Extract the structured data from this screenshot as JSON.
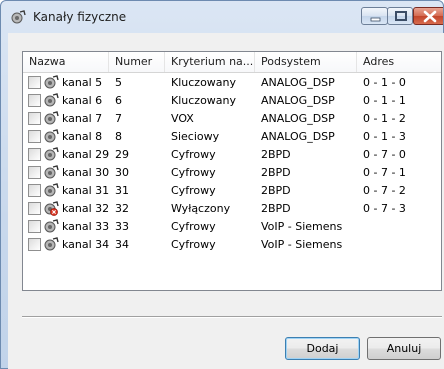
{
  "window": {
    "title": "Kanały fizyczne"
  },
  "columns": [
    "Nazwa",
    "Numer",
    "Kryterium na...",
    "Podsystem",
    "Adres"
  ],
  "rows": [
    {
      "name": "kanal 5",
      "number": "5",
      "criterion": "Kluczowany",
      "subsystem": "ANALOG_DSP",
      "address": "0 - 1 - 0",
      "icon": "channel-icon"
    },
    {
      "name": "kanal 6",
      "number": "6",
      "criterion": "Kluczowany",
      "subsystem": "ANALOG_DSP",
      "address": "0 - 1 - 1",
      "icon": "channel-icon"
    },
    {
      "name": "kanal 7",
      "number": "7",
      "criterion": "VOX",
      "subsystem": "ANALOG_DSP",
      "address": "0 - 1 - 2",
      "icon": "channel-icon"
    },
    {
      "name": "kanal 8",
      "number": "8",
      "criterion": "Sieciowy",
      "subsystem": "ANALOG_DSP",
      "address": "0 - 1 - 3",
      "icon": "channel-icon"
    },
    {
      "name": "kanal 29",
      "number": "29",
      "criterion": "Cyfrowy",
      "subsystem": "2BPD",
      "address": "0 - 7 - 0",
      "icon": "channel-icon"
    },
    {
      "name": "kanal 30",
      "number": "30",
      "criterion": "Cyfrowy",
      "subsystem": "2BPD",
      "address": "0 - 7 - 1",
      "icon": "channel-icon"
    },
    {
      "name": "kanal 31",
      "number": "31",
      "criterion": "Cyfrowy",
      "subsystem": "2BPD",
      "address": "0 - 7 - 2",
      "icon": "channel-icon"
    },
    {
      "name": "kanal 32",
      "number": "32",
      "criterion": "Wyłączony",
      "subsystem": "2BPD",
      "address": "0 - 7 - 3",
      "icon": "channel-disabled-icon"
    },
    {
      "name": "kanal 33",
      "number": "33",
      "criterion": "Cyfrowy",
      "subsystem": "VoIP - Siemens",
      "address": "",
      "icon": "channel-icon"
    },
    {
      "name": "kanal 34",
      "number": "34",
      "criterion": "Cyfrowy",
      "subsystem": "VoIP - Siemens",
      "address": "",
      "icon": "channel-icon"
    }
  ],
  "buttons": {
    "add": "Dodaj",
    "cancel": "Anuluj"
  },
  "colors": {
    "title_bar": "#c8d8ec",
    "close_button": "#c2452b",
    "default_button_border": "#3c7fb1",
    "list_border": "#828790"
  }
}
